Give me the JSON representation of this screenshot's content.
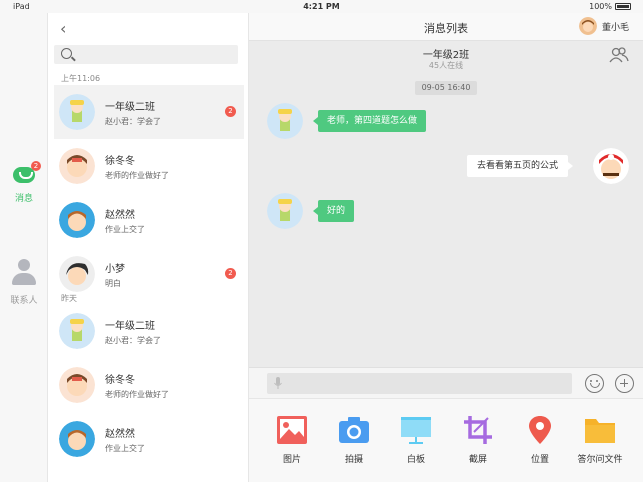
{
  "status_bar": {
    "device": "iPad",
    "time": "4:21 PM",
    "battery": "100%"
  },
  "rail": {
    "messages": {
      "label": "消息",
      "badge": "2"
    },
    "contacts": {
      "label": "联系人"
    }
  },
  "list": {
    "search_placeholder": "",
    "sections": [
      "上午11:06",
      "昨天"
    ],
    "conversations": [
      {
        "name": "一年级二班",
        "preview": "赵小君：学会了",
        "unread": "2"
      },
      {
        "name": "徐冬冬",
        "preview": "老师的作业做好了"
      },
      {
        "name": "赵然然",
        "preview": "作业上交了"
      },
      {
        "name": "小梦",
        "preview": "明白",
        "unread": "2"
      },
      {
        "name": "一年级二班",
        "preview": "赵小君：学会了"
      },
      {
        "name": "徐冬冬",
        "preview": "老师的作业做好了"
      },
      {
        "name": "赵然然",
        "preview": "作业上交了"
      }
    ]
  },
  "chat": {
    "header_title": "消息列表",
    "user_name": "董小毛",
    "group_name": "一年级2班",
    "group_sub": "45人在线",
    "timestamp": "09-05  16:40",
    "messages": [
      {
        "side": "in",
        "text": "老师，第四道题怎么做"
      },
      {
        "side": "out",
        "text": "去看看第五页的公式"
      },
      {
        "side": "in",
        "text": "好的"
      }
    ],
    "input_placeholder": ""
  },
  "tools": [
    {
      "label": "图片",
      "icon": "picture-icon",
      "color": "#f0605b"
    },
    {
      "label": "拍摄",
      "icon": "camera-icon",
      "color": "#4a9cf0"
    },
    {
      "label": "白板",
      "icon": "whiteboard-icon",
      "color": "#5dcbf2"
    },
    {
      "label": "截屏",
      "icon": "crop-icon",
      "color": "#a66be0"
    },
    {
      "label": "位置",
      "icon": "location-icon",
      "color": "#ee5a4d"
    },
    {
      "label": "答尔问文件",
      "icon": "folder-icon",
      "color": "#f6b22a"
    }
  ],
  "colors": {
    "accent": "#3cbf6a",
    "bubble_in": "#4fc980",
    "badge": "#f15b4f"
  }
}
